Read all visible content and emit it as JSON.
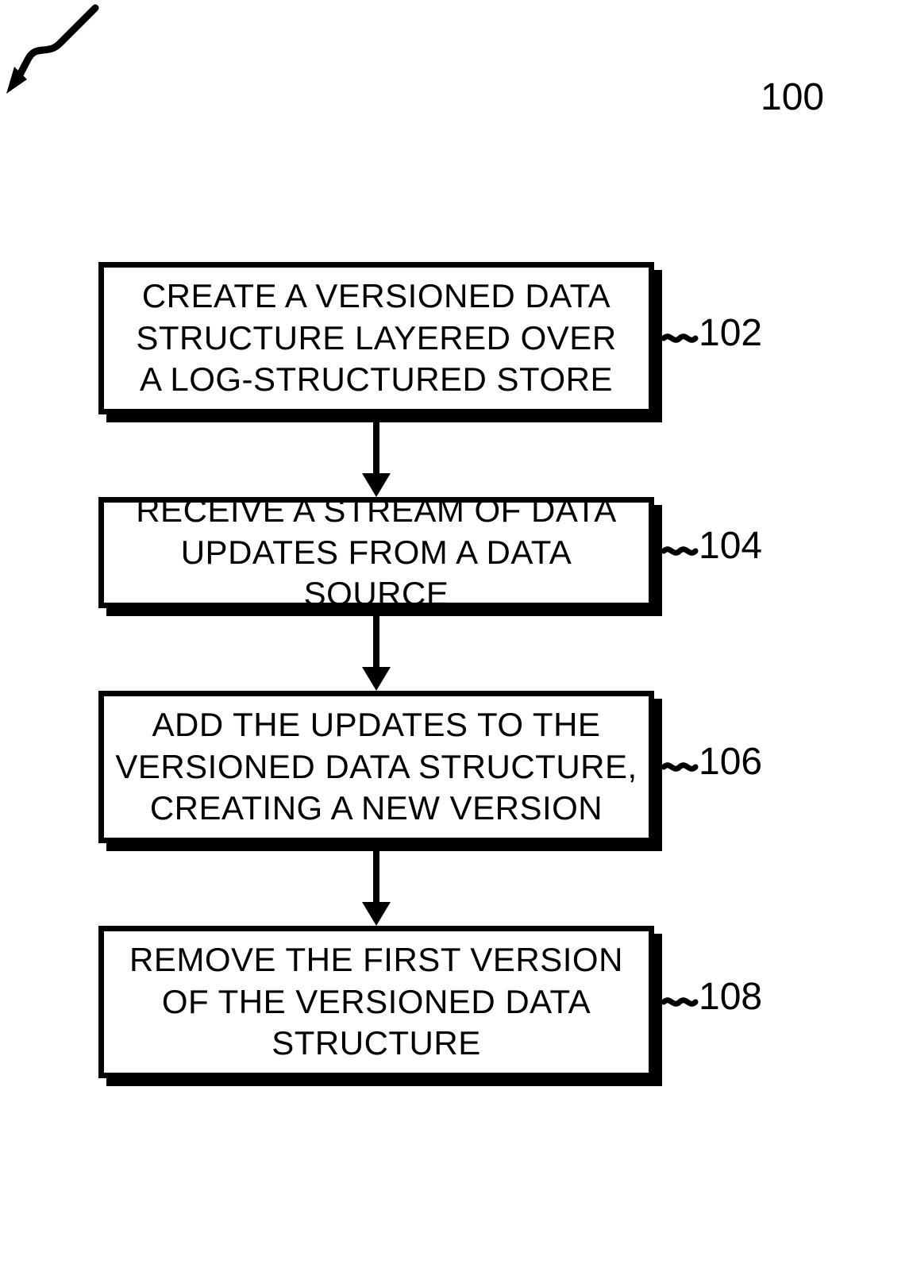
{
  "title_ref": "100",
  "steps": [
    {
      "ref": "102",
      "text": "CREATE A VERSIONED DATA\nSTRUCTURE LAYERED OVER\nA LOG-STRUCTURED STORE"
    },
    {
      "ref": "104",
      "text": "RECEIVE A STREAM OF DATA\nUPDATES FROM A DATA SOURCE"
    },
    {
      "ref": "106",
      "text": "ADD THE UPDATES TO THE\nVERSIONED DATA STRUCTURE,\nCREATING A NEW VERSION"
    },
    {
      "ref": "108",
      "text": "REMOVE THE FIRST VERSION\nOF THE VERSIONED DATA\nSTRUCTURE"
    }
  ]
}
